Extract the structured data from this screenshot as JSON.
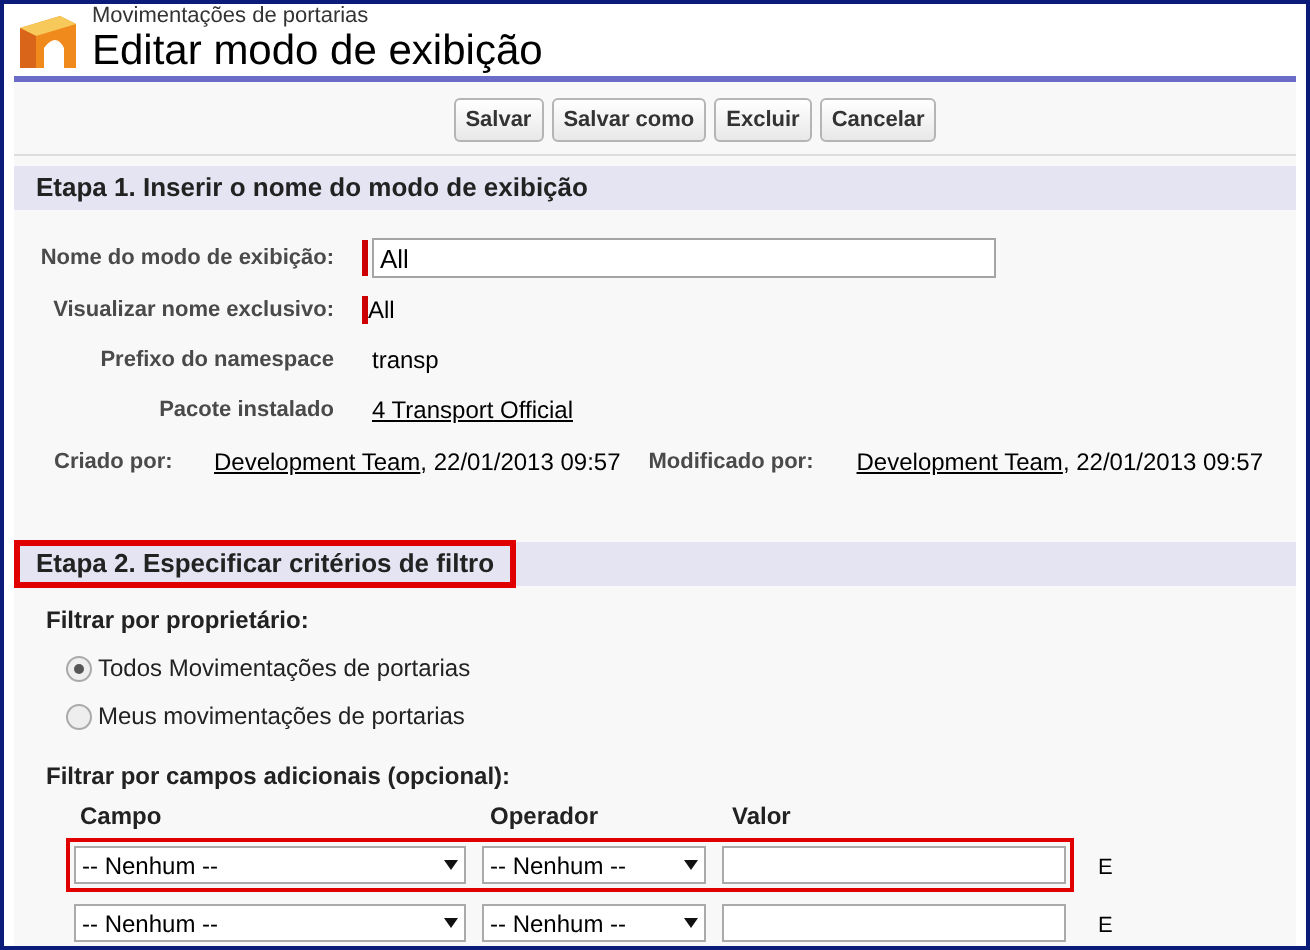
{
  "header": {
    "breadcrumb": "Movimentações de portarias",
    "title": "Editar modo de exibição"
  },
  "buttons": [
    "Salvar",
    "Salvar como",
    "Excluir",
    "Cancelar"
  ],
  "step1": {
    "title": "Etapa 1. Inserir o nome do modo de exibição",
    "highlighted": false,
    "name_label": "Nome do modo de exibição:",
    "name_value": "All",
    "unique_label": "Visualizar nome exclusivo:",
    "unique_value": "All",
    "namespace_label": "Prefixo do namespace",
    "namespace_value": "transp",
    "package_label": "Pacote instalado",
    "package_value": "4 Transport Official",
    "created_label": "Criado por:",
    "created_by": "Development Team",
    "created_at": ", 22/01/2013 09:57",
    "modified_label": "Modificado por:",
    "modified_by": "Development Team",
    "modified_at": ", 22/01/2013 09:57"
  },
  "step2": {
    "title": "Etapa 2. Especificar critérios de filtro",
    "highlighted": true,
    "owner_label": "Filtrar por proprietário:",
    "owner_options": [
      {
        "label": "Todos Movimentações de portarias",
        "selected": true
      },
      {
        "label": "Meus movimentações de portarias",
        "selected": false
      }
    ],
    "fields_label": "Filtrar por campos adicionais (opcional):",
    "columns": [
      "Campo",
      "Operador",
      "Valor"
    ],
    "rows": [
      {
        "field": "-- Nenhum --",
        "operator": "-- Nenhum --",
        "conjunction": "E",
        "highlighted": true
      },
      {
        "field": "-- Nenhum --",
        "operator": "-- Nenhum --",
        "conjunction": "E",
        "highlighted": false
      }
    ]
  }
}
